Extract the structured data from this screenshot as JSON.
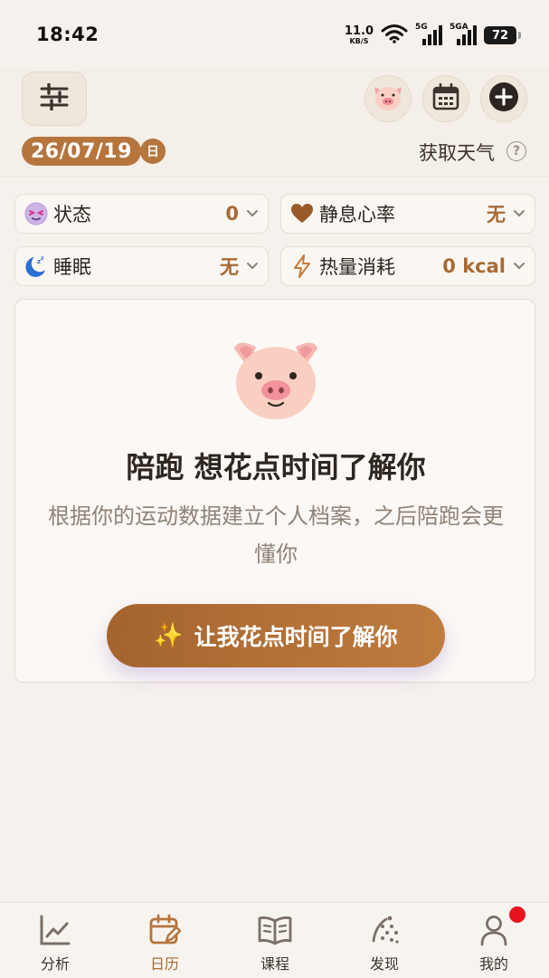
{
  "status_bar": {
    "time": "18:42",
    "net_speed_value": "11.0",
    "net_speed_unit": "KB/S",
    "signal_1_label": "5G",
    "signal_2_label": "5GA",
    "battery": "72"
  },
  "header": {
    "date": "26/07/19",
    "day_badge": "日",
    "weather_link": "获取天气",
    "help_glyph": "?"
  },
  "metrics": [
    {
      "label": "状态",
      "value": "0",
      "icon": "status-face-icon"
    },
    {
      "label": "静息心率",
      "value": "无",
      "icon": "heart-icon"
    },
    {
      "label": "睡眠",
      "value": "无",
      "icon": "sleep-moon-icon"
    },
    {
      "label": "热量消耗",
      "value": "0 kcal",
      "icon": "lightning-icon"
    }
  ],
  "onboarding": {
    "title": "陪跑 想花点时间了解你",
    "description": "根据你的运动数据建立个人档案，之后陪跑会更懂你",
    "cta_spark": "✨",
    "cta_label": "让我花点时间了解你"
  },
  "bottom_nav": [
    {
      "label": "分析",
      "icon": "chart-icon",
      "active": false
    },
    {
      "label": "日历",
      "icon": "calendar-edit-icon",
      "active": true
    },
    {
      "label": "课程",
      "icon": "book-icon",
      "active": false
    },
    {
      "label": "发现",
      "icon": "discover-icon",
      "active": false
    },
    {
      "label": "我的",
      "icon": "profile-icon",
      "active": false,
      "badge": true
    }
  ],
  "colors": {
    "accent": "#b5753c",
    "value_text": "#a86a34",
    "background": "#f6f1ec",
    "badge_red": "#e8131f"
  }
}
